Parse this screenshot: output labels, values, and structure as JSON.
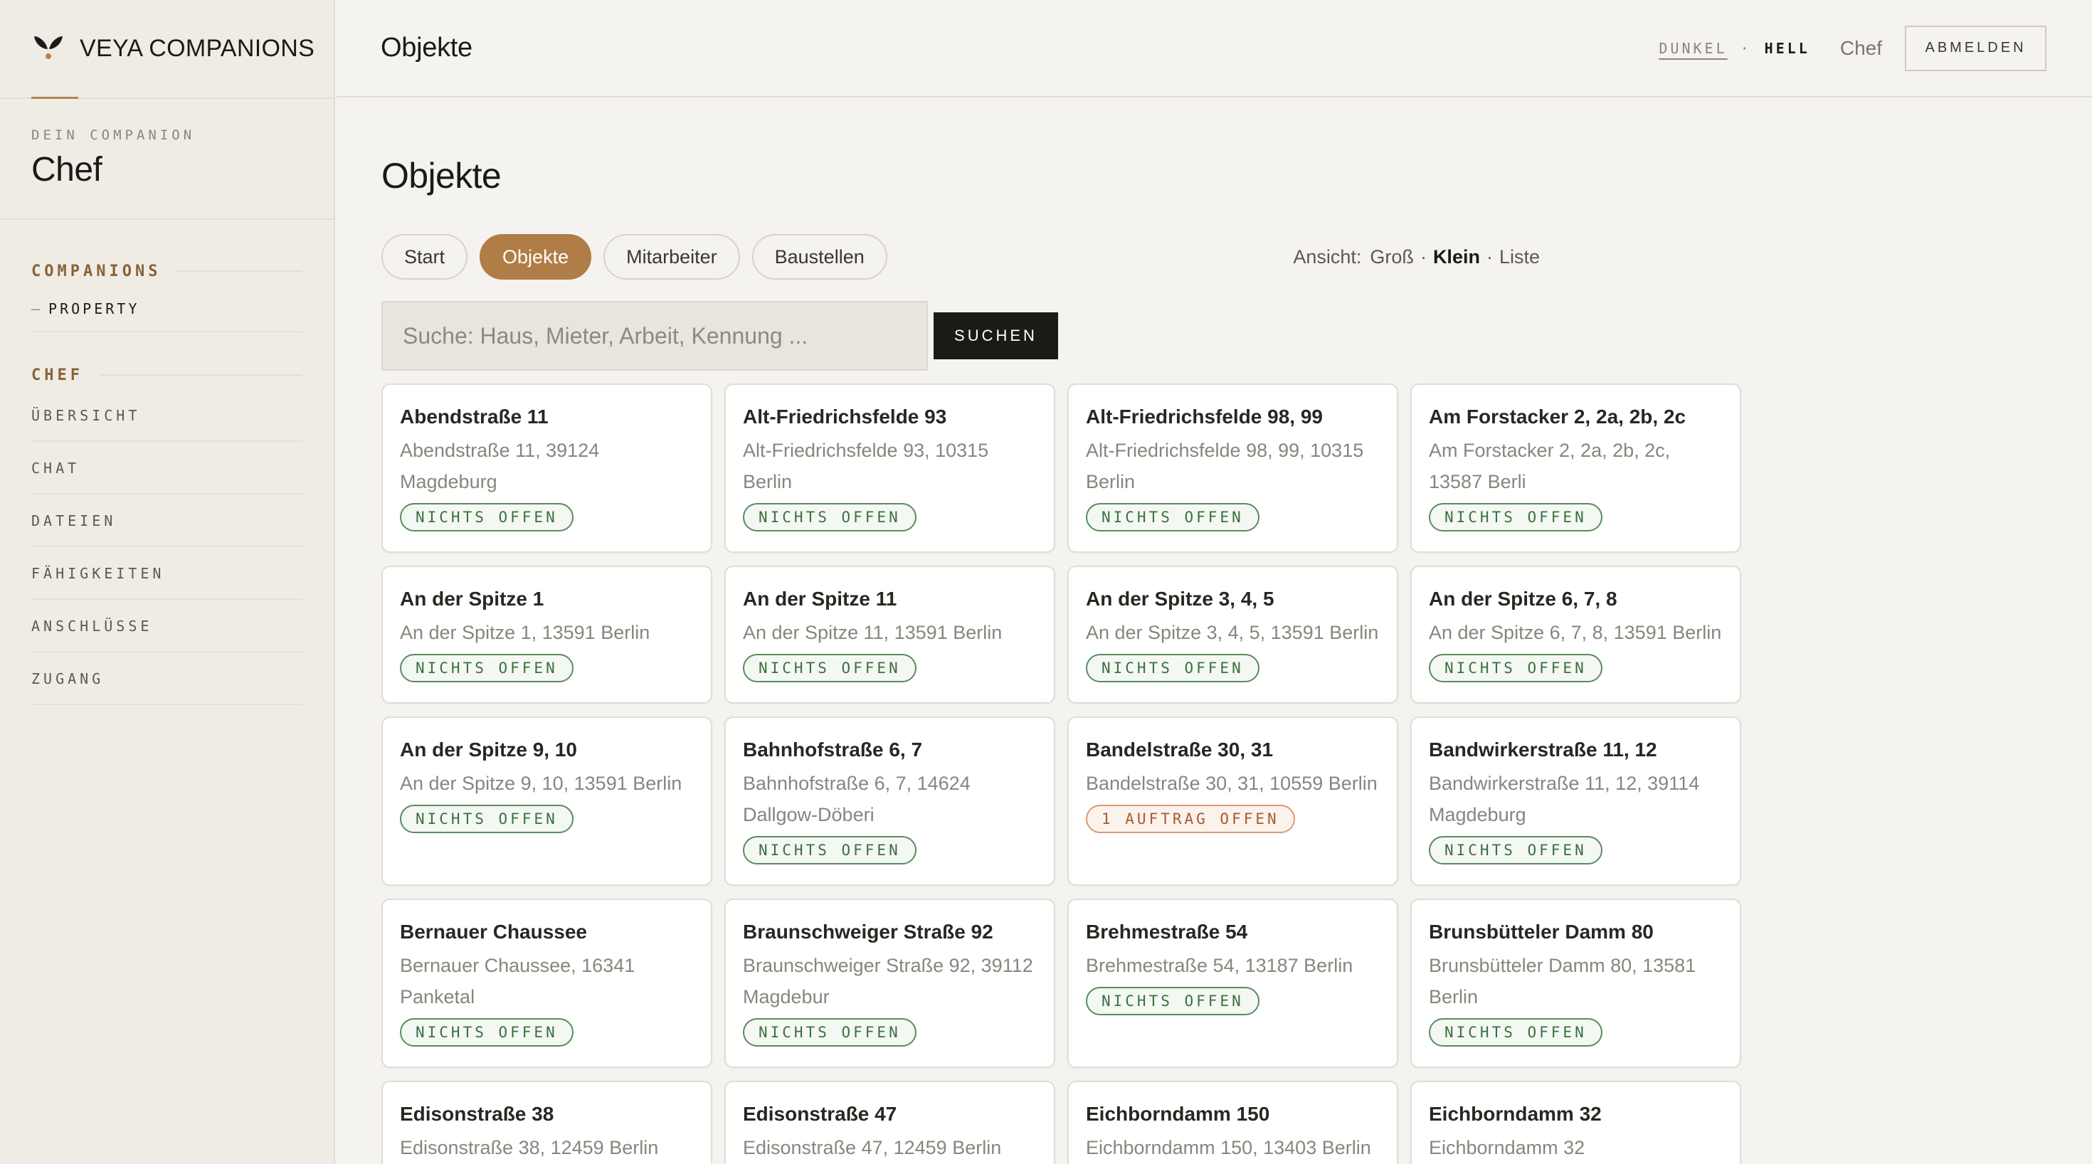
{
  "brand": {
    "name": "VEYA COMPANIONS",
    "accent": "#b38350"
  },
  "companion": {
    "label": "DEIN COMPANION",
    "name": "Chef"
  },
  "nav": {
    "companions_heading": "COMPANIONS",
    "companions_items": [
      {
        "dash": "—",
        "label": "PROPERTY"
      }
    ],
    "chef_heading": "CHEF",
    "chef_items": [
      "ÜBERSICHT",
      "CHAT",
      "DATEIEN",
      "FÄHIGKEITEN",
      "ANSCHLÜSSE",
      "ZUGANG"
    ]
  },
  "topbar": {
    "title": "Objekte",
    "theme_dark": "DUNKEL",
    "theme_sep": "·",
    "theme_light": "HELL",
    "user": "Chef",
    "logout": "ABMELDEN"
  },
  "main": {
    "title": "Objekte",
    "tabs": [
      {
        "label": "Start",
        "active": false
      },
      {
        "label": "Objekte",
        "active": true
      },
      {
        "label": "Mitarbeiter",
        "active": false
      },
      {
        "label": "Baustellen",
        "active": false
      }
    ],
    "view": {
      "label": "Ansicht:",
      "options": [
        "Groß",
        "Klein",
        "Liste"
      ],
      "sep": "·",
      "selected": "Klein"
    },
    "search": {
      "placeholder": "Suche: Haus, Mieter, Arbeit, Kennung ...",
      "value": "",
      "button": "SUCHEN"
    }
  },
  "properties": [
    {
      "title": "Abendstraße 11",
      "address": "Abendstraße 11, 39124 Magdeburg",
      "status": "NICHTS OFFEN",
      "status_type": "ok"
    },
    {
      "title": "Alt-Friedrichsfelde 93",
      "address": "Alt-Friedrichsfelde 93, 10315 Berlin",
      "status": "NICHTS OFFEN",
      "status_type": "ok"
    },
    {
      "title": "Alt-Friedrichsfelde 98, 99",
      "address": "Alt-Friedrichsfelde 98, 99, 10315 Berlin",
      "status": "NICHTS OFFEN",
      "status_type": "ok"
    },
    {
      "title": "Am Forstacker 2, 2a, 2b, 2c",
      "address": "Am Forstacker 2, 2a, 2b, 2c, 13587 Berli",
      "status": "NICHTS OFFEN",
      "status_type": "ok"
    },
    {
      "title": "An der Spitze 1",
      "address": "An der Spitze 1, 13591 Berlin",
      "status": "NICHTS OFFEN",
      "status_type": "ok"
    },
    {
      "title": "An der Spitze 11",
      "address": "An der Spitze 11, 13591 Berlin",
      "status": "NICHTS OFFEN",
      "status_type": "ok"
    },
    {
      "title": "An der Spitze 3, 4, 5",
      "address": "An der Spitze 3, 4, 5, 13591 Berlin",
      "status": "NICHTS OFFEN",
      "status_type": "ok"
    },
    {
      "title": "An der Spitze 6, 7, 8",
      "address": "An der Spitze 6, 7, 8, 13591 Berlin",
      "status": "NICHTS OFFEN",
      "status_type": "ok"
    },
    {
      "title": "An der Spitze 9, 10",
      "address": "An der Spitze 9, 10, 13591 Berlin",
      "status": "NICHTS OFFEN",
      "status_type": "ok"
    },
    {
      "title": "Bahnhofstraße 6, 7",
      "address": "Bahnhofstraße 6, 7, 14624 Dallgow-Döberi",
      "status": "NICHTS OFFEN",
      "status_type": "ok"
    },
    {
      "title": "Bandelstraße 30, 31",
      "address": "Bandelstraße 30, 31, 10559 Berlin",
      "status": "1 AUFTRAG OFFEN",
      "status_type": "warn"
    },
    {
      "title": "Bandwirkerstraße 11, 12",
      "address": "Bandwirkerstraße 11, 12, 39114 Magdeburg",
      "status": "NICHTS OFFEN",
      "status_type": "ok"
    },
    {
      "title": "Bernauer Chaussee",
      "address": "Bernauer Chaussee, 16341 Panketal",
      "status": "NICHTS OFFEN",
      "status_type": "ok"
    },
    {
      "title": "Braunschweiger Straße 92",
      "address": "Braunschweiger Straße 92, 39112 Magdebur",
      "status": "NICHTS OFFEN",
      "status_type": "ok"
    },
    {
      "title": "Brehmestraße 54",
      "address": "Brehmestraße 54, 13187 Berlin",
      "status": "NICHTS OFFEN",
      "status_type": "ok"
    },
    {
      "title": "Brunsbütteler Damm 80",
      "address": "Brunsbütteler Damm 80, 13581 Berlin",
      "status": "NICHTS OFFEN",
      "status_type": "ok"
    },
    {
      "title": "Edisonstraße 38",
      "address": "Edisonstraße 38, 12459 Berlin",
      "status": "",
      "status_type": "ok"
    },
    {
      "title": "Edisonstraße 47",
      "address": "Edisonstraße 47, 12459 Berlin",
      "status": "",
      "status_type": "ok"
    },
    {
      "title": "Eichborndamm 150",
      "address": "Eichborndamm 150, 13403 Berlin",
      "status": "",
      "status_type": "ok"
    },
    {
      "title": "Eichborndamm 32",
      "address": "Eichborndamm 32",
      "status": "",
      "status_type": "ok"
    }
  ],
  "colors": {
    "background": "#f5f3ef",
    "sidebar": "#efece6",
    "accent": "#b07d46",
    "ok_badge": "#3d6f41",
    "warn_badge": "#a75a30",
    "button_dark": "#1c1a17"
  },
  "icons": {
    "logo": "veya-leaf-logo-icon"
  }
}
